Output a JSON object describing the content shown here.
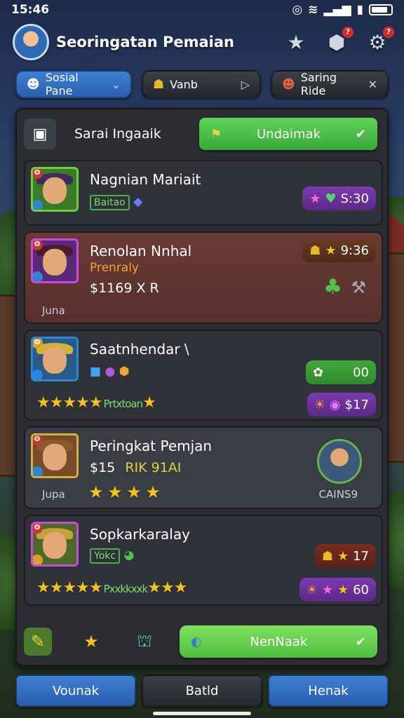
{
  "status_bar": {
    "time": "15:46"
  },
  "header": {
    "title": "Seoringatan Pemaian"
  },
  "filters": [
    {
      "label": "Sosial Pane"
    },
    {
      "label": "Vanb"
    },
    {
      "label": "Saring Ride"
    }
  ],
  "panel": {
    "top_label": "Sarai Ingaaik",
    "top_button": "Undaimak"
  },
  "cards": [
    {
      "name": "Nagnian Mariait",
      "tag": "Baitao",
      "chip_value": "S:30"
    },
    {
      "name": "Renolan Nnhal",
      "subtitle": "Prenraly",
      "price": "$1169 X R",
      "footer": "Juna",
      "chip_value": "9:36"
    },
    {
      "name": "Saatnhendar \\",
      "chip_top": "00",
      "stars_text": "Prtxtoan",
      "chip_value": "$17"
    },
    {
      "name": "Peringkat Pemjan",
      "price": "$15",
      "price_tag": "RIK 91AI",
      "footer": "Jupa",
      "side_label": "CAINS9"
    },
    {
      "name": "Sopkarkaralay",
      "tag": "Yokc",
      "chip_top": "17",
      "stars_text": "Pxxkkxxk",
      "chip_value": "60"
    }
  ],
  "action_button": "NenNaak",
  "bottom_nav": [
    "Vounak",
    "Batld",
    "Henak"
  ]
}
